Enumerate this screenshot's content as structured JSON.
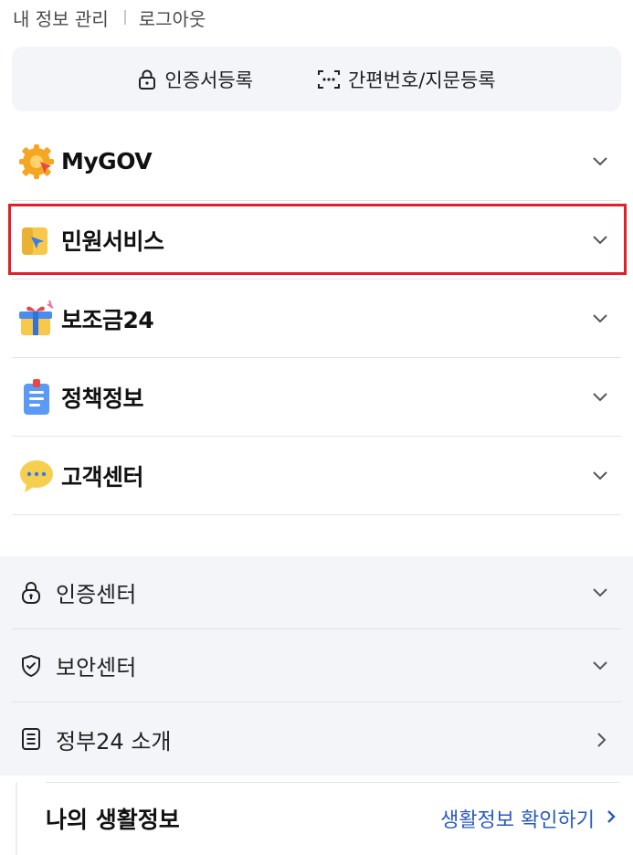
{
  "top_links": {
    "my_info": "내 정보 관리",
    "logout": "로그아웃"
  },
  "auth": {
    "certificate": "인증서등록",
    "simple": "간편번호/지문등록"
  },
  "menu": [
    {
      "label": "MyGOV",
      "icon": "gear-badge-icon"
    },
    {
      "label": "민원서비스",
      "icon": "folder-cursor-icon",
      "highlighted": true
    },
    {
      "label": "보조금24",
      "icon": "gift-box-icon"
    },
    {
      "label": "정책정보",
      "icon": "clipboard-icon"
    },
    {
      "label": "고객센터",
      "icon": "chat-bubble-icon"
    }
  ],
  "sub_menu": [
    {
      "label": "인증센터",
      "icon": "lock-icon"
    },
    {
      "label": "보안센터",
      "icon": "shield-check-icon"
    },
    {
      "label": "정부24 소개",
      "icon": "document-icon"
    }
  ],
  "life_info": {
    "title": "나의 생활정보",
    "link": "생활정보 확인하기"
  },
  "colors": {
    "highlight": "#e0202a",
    "link": "#2a5bbf",
    "panel_bg": "#f3f5f8"
  }
}
